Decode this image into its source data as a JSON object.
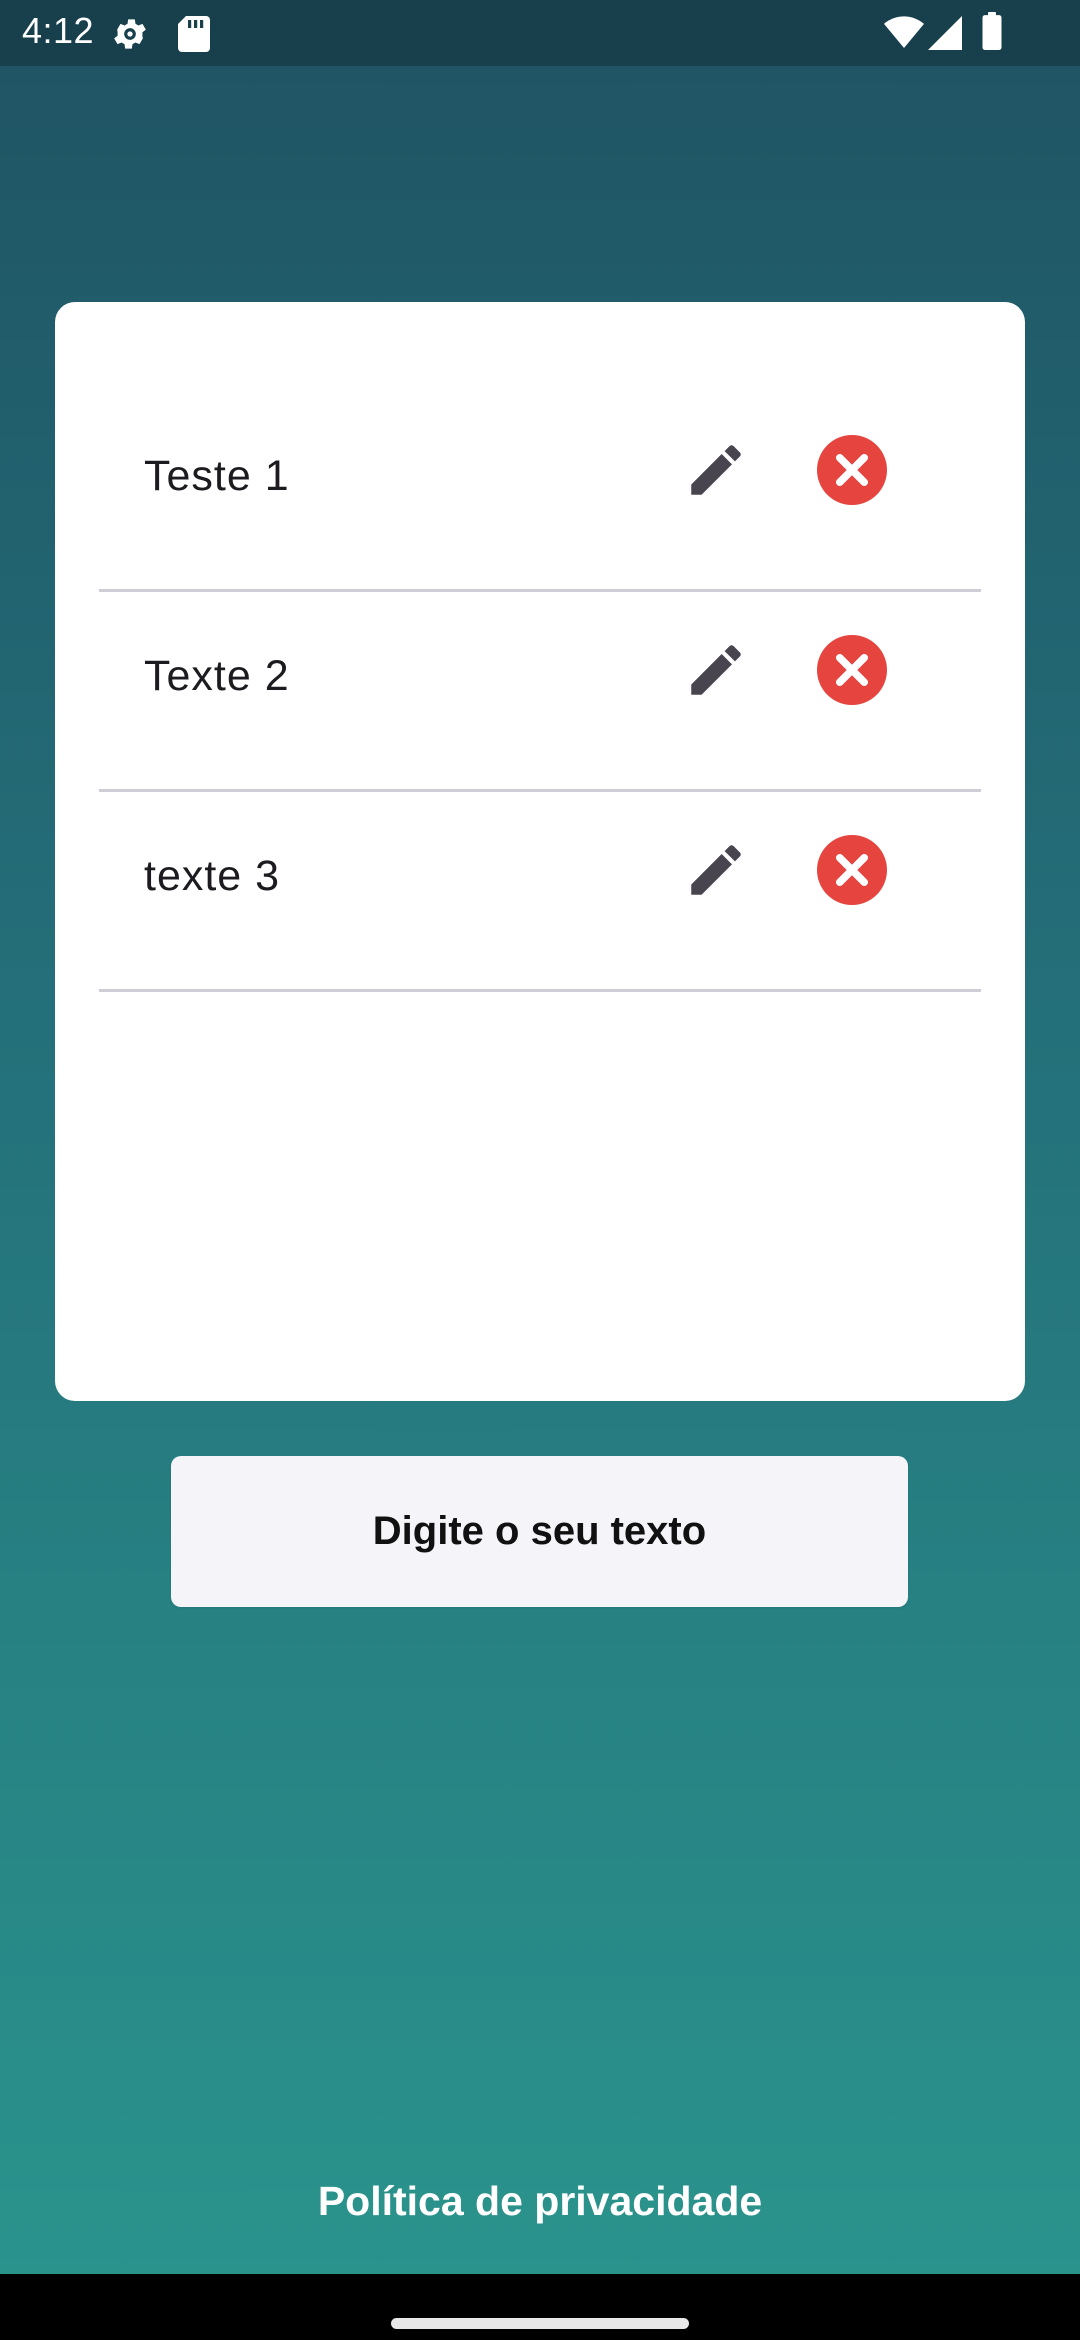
{
  "status_bar": {
    "time": "4:12",
    "icons": [
      "settings-gear-icon",
      "sd-card-icon",
      "wifi-icon",
      "cell-signal-icon",
      "battery-icon"
    ]
  },
  "list": {
    "items": [
      {
        "label": "Teste 1"
      },
      {
        "label": "Texte 2"
      },
      {
        "label": "texte 3"
      }
    ],
    "icons": {
      "edit": "pencil-icon",
      "delete": "close-circle-icon"
    }
  },
  "input_button": {
    "label": "Digite o seu texto"
  },
  "footer": {
    "privacy_label": "Política de privacidade"
  },
  "colors": {
    "gradient_top": "#1f5363",
    "gradient_bottom": "#2a938c",
    "status_bar": "#173f4c",
    "delete_red": "#e5443f",
    "icon_gray": "#49454f"
  }
}
